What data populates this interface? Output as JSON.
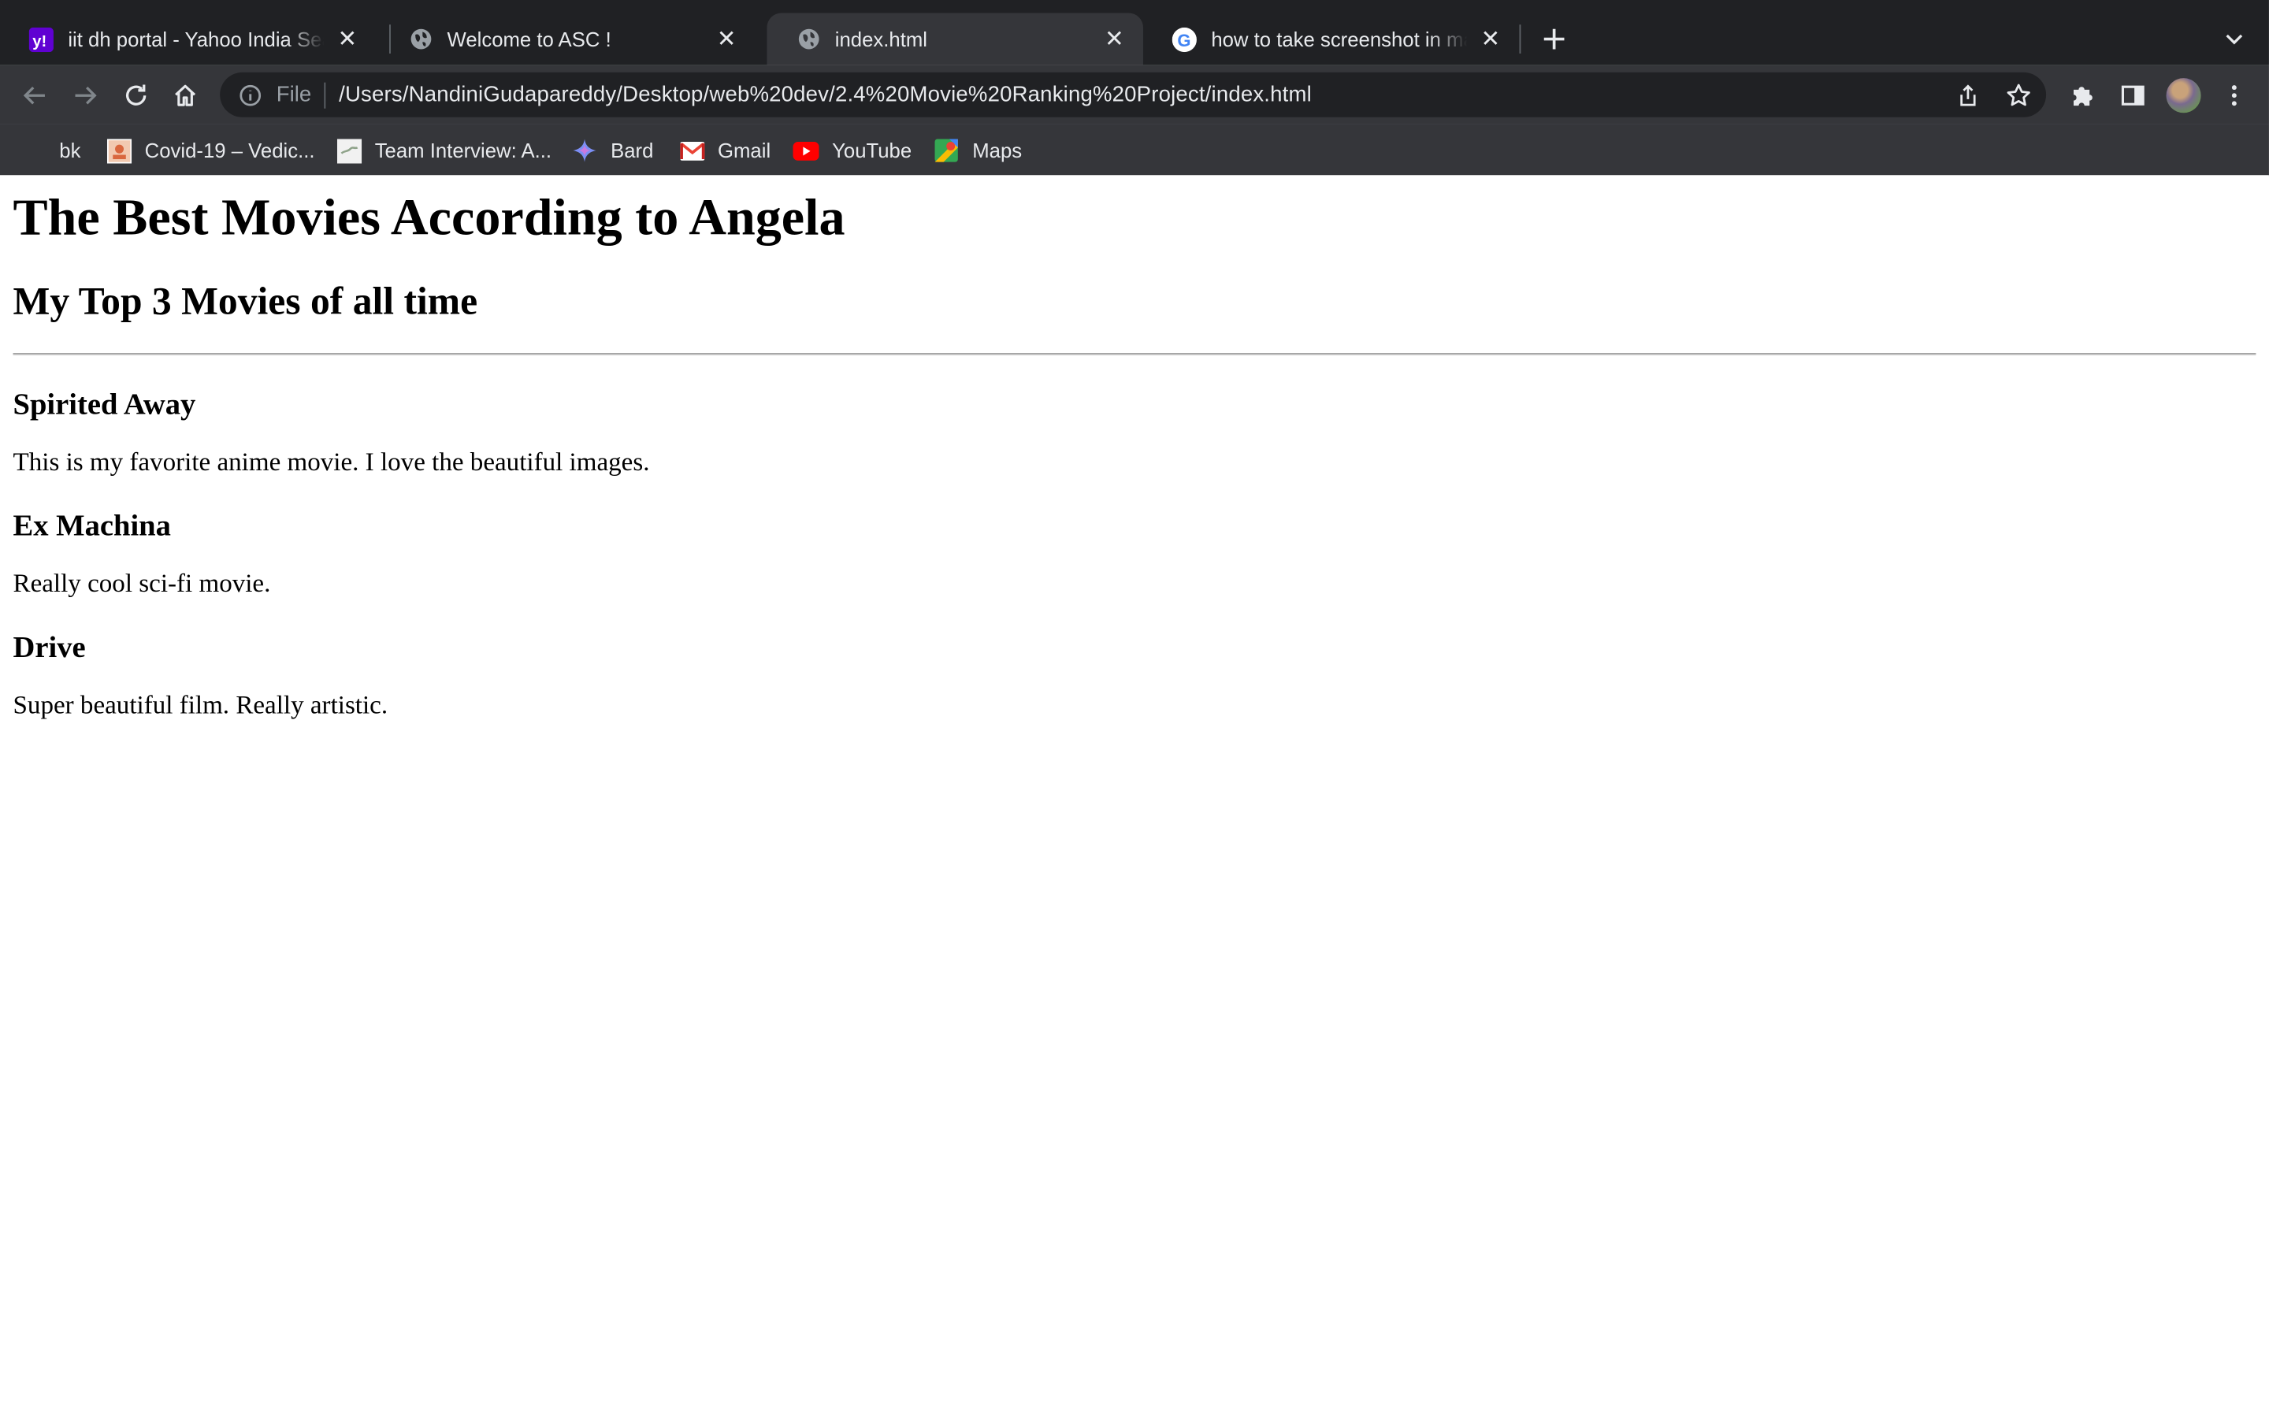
{
  "browser": {
    "tabs": [
      {
        "title": "iit dh portal - Yahoo India Search Results",
        "favicon": "yahoo-icon",
        "active": false
      },
      {
        "title": "Welcome to ASC !",
        "favicon": "globe-icon",
        "active": false
      },
      {
        "title": "index.html",
        "favicon": "globe-icon",
        "active": true
      },
      {
        "title": "how to take screenshot in mac - Google Search",
        "favicon": "google-icon",
        "active": false
      }
    ],
    "address_bar": {
      "scheme": "File",
      "url": "/Users/NandiniGudapareddy/Desktop/web%20dev/2.4%20Movie%20Ranking%20Project/index.html"
    },
    "bookmarks": [
      {
        "label": "bk",
        "icon": "folder-icon"
      },
      {
        "label": "Covid-19 – Vedic...",
        "icon": "covid-site-icon"
      },
      {
        "label": "Team Interview: A...",
        "icon": "team-site-icon"
      },
      {
        "label": "Bard",
        "icon": "bard-icon"
      },
      {
        "label": "Gmail",
        "icon": "gmail-icon"
      },
      {
        "label": "YouTube",
        "icon": "youtube-icon"
      },
      {
        "label": "Maps",
        "icon": "maps-icon"
      }
    ],
    "colors": {
      "tabstrip": "#202124",
      "toolbar": "#35363a",
      "text": "#e8eaed"
    }
  },
  "page": {
    "title": "The Best Movies According to Angela",
    "subtitle": "My Top 3 Movies of all time",
    "movies": [
      {
        "name": "Spirited Away",
        "description": "This is my favorite anime movie. I love the beautiful images."
      },
      {
        "name": "Ex Machina",
        "description": "Really cool sci-fi movie."
      },
      {
        "name": "Drive",
        "description": "Super beautiful film. Really artistic."
      }
    ]
  }
}
